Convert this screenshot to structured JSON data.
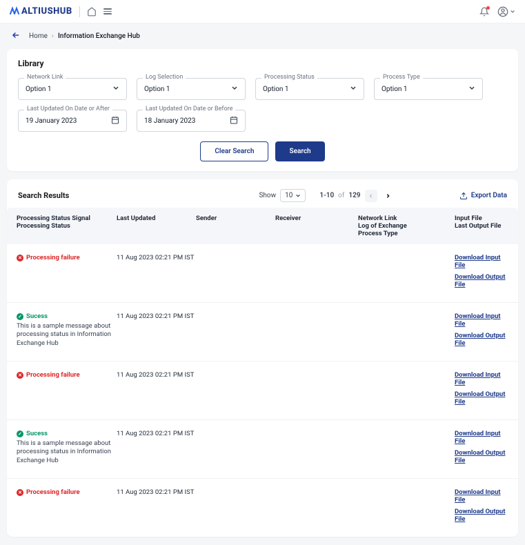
{
  "header": {
    "brand": "ALTIUSHUB"
  },
  "breadcrumb": {
    "home": "Home",
    "current": "Information Exchange Hub"
  },
  "library": {
    "title": "Library",
    "filters": {
      "networkLink": {
        "label": "Network Link",
        "value": "Option 1"
      },
      "logSelection": {
        "label": "Log Selection",
        "value": "Option 1"
      },
      "processingStatus": {
        "label": "Processing Status",
        "value": "Option 1"
      },
      "processType": {
        "label": "Process Type",
        "value": "Option 1"
      },
      "dateAfter": {
        "label": "Last Updated On Date or After",
        "value": "19 January 2023"
      },
      "dateBefore": {
        "label": "Last Updated On Date or Before",
        "value": "18 January 2023"
      }
    },
    "buttons": {
      "clear": "Clear Search",
      "search": "Search"
    }
  },
  "results": {
    "title": "Search Results",
    "showLabel": "Show",
    "pageSize": "10",
    "range": "1-10",
    "ofLabel": "of",
    "total": "129",
    "export": "Export Data",
    "headers": {
      "col1a": "Processing Status Signal",
      "col1b": "Processing Status",
      "col2": "Last Updated",
      "col3": "Sender",
      "col4": "Receiver",
      "col5a": "Network Link",
      "col5b": "Log of Exchange",
      "col5c": "Process Type",
      "col6a": "Input File",
      "col6b": "Last Output File"
    },
    "downloadInput": "Download Input File",
    "downloadOutput": "Download Output File",
    "sampleMsg": "This is a sample message about processing status in Information Exchange Hub",
    "rows": [
      {
        "status": "fail",
        "statusText": "Processing failure",
        "ts": "11 Aug 2023 02:21 PM IST",
        "msg": false
      },
      {
        "status": "ok",
        "statusText": "Sucess",
        "ts": "11 Aug 2023 02:21 PM IST",
        "msg": true
      },
      {
        "status": "fail",
        "statusText": "Processing failure",
        "ts": "11 Aug 2023 02:21 PM IST",
        "msg": false
      },
      {
        "status": "ok",
        "statusText": "Sucess",
        "ts": "11 Aug 2023 02:21 PM IST",
        "msg": true
      },
      {
        "status": "fail",
        "statusText": "Processing failure",
        "ts": "11 Aug 2023 02:21 PM IST",
        "msg": false
      }
    ]
  }
}
